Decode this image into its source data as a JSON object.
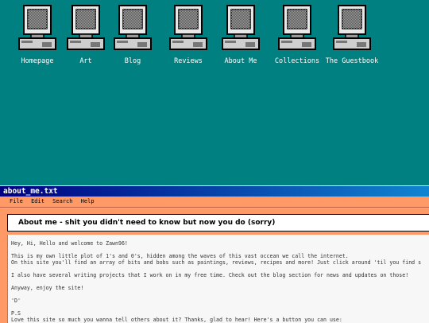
{
  "desktop": {
    "icons": [
      {
        "label": "Homepage",
        "icon": "computer-icon"
      },
      {
        "label": "Art",
        "icon": "computer-icon"
      },
      {
        "label": "Blog",
        "icon": "computer-icon"
      },
      {
        "label": "Reviews",
        "icon": "computer-icon"
      },
      {
        "label": "About Me",
        "icon": "computer-icon"
      },
      {
        "label": "Collections",
        "icon": "computer-icon"
      },
      {
        "label": "The Guestbook",
        "icon": "computer-icon"
      }
    ]
  },
  "window": {
    "title": "about_me.txt",
    "menu": [
      "File",
      "Edit",
      "Search",
      "Help"
    ],
    "heading": "About me - shit you didn't need to know but now you do (sorry)",
    "paragraphs": [
      "Hey, Hi, Hello and welcome to Zawn96!",
      "This is my own little plot of 1's and 0's, hidden among the waves of this vast occean we call the internet.",
      "On this site you'll find an array of bits and bobs such as paintings, reviews, recipes and more! Just click around 'til you find s",
      "I also have several writing projects that I work on in my free time. Check out the blog section for news and updates on those!",
      "Anyway, enjoy the site!",
      "'D'",
      "P.S",
      "Love this site so much you wanna tell others about it? Thanks, glad to hear! Here's a button you can use:"
    ]
  },
  "colors": {
    "desktop": "#008080",
    "titlebar_start": "#000080",
    "titlebar_end": "#1084d0",
    "window_accent": "#ff9966",
    "text_panel": "#f7f7f7"
  }
}
